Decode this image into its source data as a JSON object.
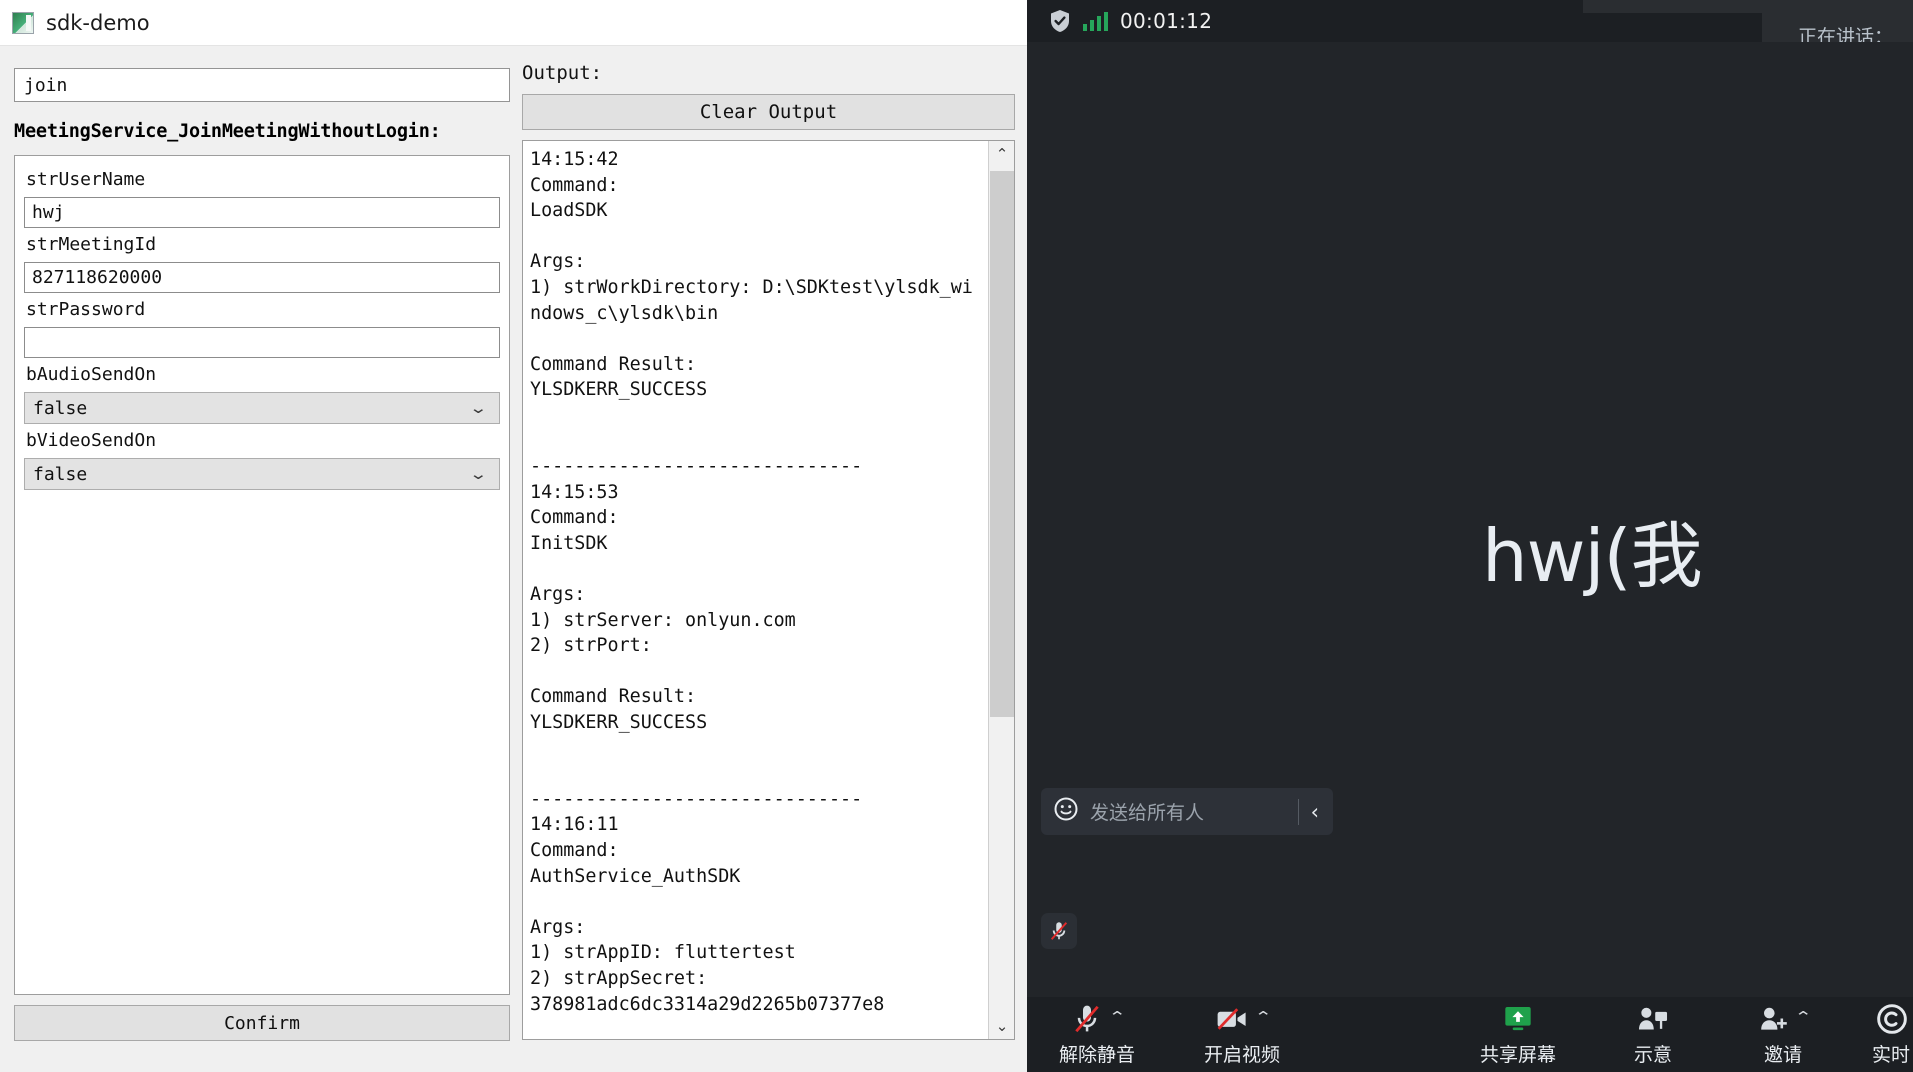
{
  "sdk_window": {
    "title": "sdk-demo",
    "app_icon": "app-window-icon",
    "command_search": {
      "value": "join",
      "placeholder": ""
    },
    "api_heading": "MeetingService_JoinMeetingWithoutLogin:",
    "params": [
      {
        "label": "strUserName",
        "type": "text",
        "value": "hwj"
      },
      {
        "label": "strMeetingId",
        "type": "text",
        "value": "827118620000"
      },
      {
        "label": "strPassword",
        "type": "text",
        "value": ""
      },
      {
        "label": "bAudioSendOn",
        "type": "select",
        "value": "false",
        "options": [
          "false",
          "true"
        ]
      },
      {
        "label": "bVideoSendOn",
        "type": "select",
        "value": "false",
        "options": [
          "false",
          "true"
        ]
      }
    ],
    "confirm_label": "Confirm",
    "output_label": "Output:",
    "clear_output_label": "Clear Output",
    "log_text": "14:15:42\nCommand:\nLoadSDK\n\nArgs:\n1) strWorkDirectory: D:\\SDKtest\\ylsdk_windows_c\\ylsdk\\bin\n\nCommand Result:\nYLSDKERR_SUCCESS\n\n\n------------------------------\n14:15:53\nCommand:\nInitSDK\n\nArgs:\n1) strServer: onlyun.com\n2) strPort:\n\nCommand Result:\nYLSDKERR_SUCCESS\n\n\n------------------------------\n14:16:11\nCommand:\nAuthService_AuthSDK\n\nArgs:\n1) strAppID: fluttertest\n2) strAppSecret:\n378981adc6dc3314a29d2265b07377e8",
    "scrollbar": {
      "up_arrow": "chevron-up",
      "down_arrow": "chevron-down"
    }
  },
  "meeting_window": {
    "topbar": {
      "shield_icon": "shield-check-icon",
      "signal_icon": "signal-bars-icon",
      "timer": "00:01:12",
      "speaking_banner": "正在讲话：",
      "clipped_top_text": ""
    },
    "stage": {
      "video_tile_name": "hwj(我",
      "mic_status_icon": "mic-muted-icon"
    },
    "chat": {
      "emoji_icon": "emoji-smiley-icon",
      "placeholder": "发送给所有人",
      "collapse_icon": "chevron-left-icon"
    },
    "toolbar": [
      {
        "icon": "mic-muted-icon",
        "label": "解除静音",
        "caret": true,
        "highlight": false
      },
      {
        "icon": "video-off-icon",
        "label": "开启视频",
        "caret": true,
        "highlight": false
      },
      {
        "icon": "share-screen-icon",
        "label": "共享屏幕",
        "caret": false,
        "highlight": true
      },
      {
        "icon": "raise-hand-icon",
        "label": "示意",
        "caret": false,
        "highlight": false
      },
      {
        "icon": "invite-user-icon",
        "label": "邀请",
        "caret": true,
        "highlight": false
      },
      {
        "icon": "live-caption-icon",
        "label": "实时",
        "caret": false,
        "highlight": false
      }
    ],
    "colors": {
      "accent_green": "#1fa14b",
      "signal_green": "#26a65b",
      "mute_red": "#e02b2b",
      "panel_bg": "#222529",
      "toolbar_bg": "#1c1f23"
    }
  }
}
